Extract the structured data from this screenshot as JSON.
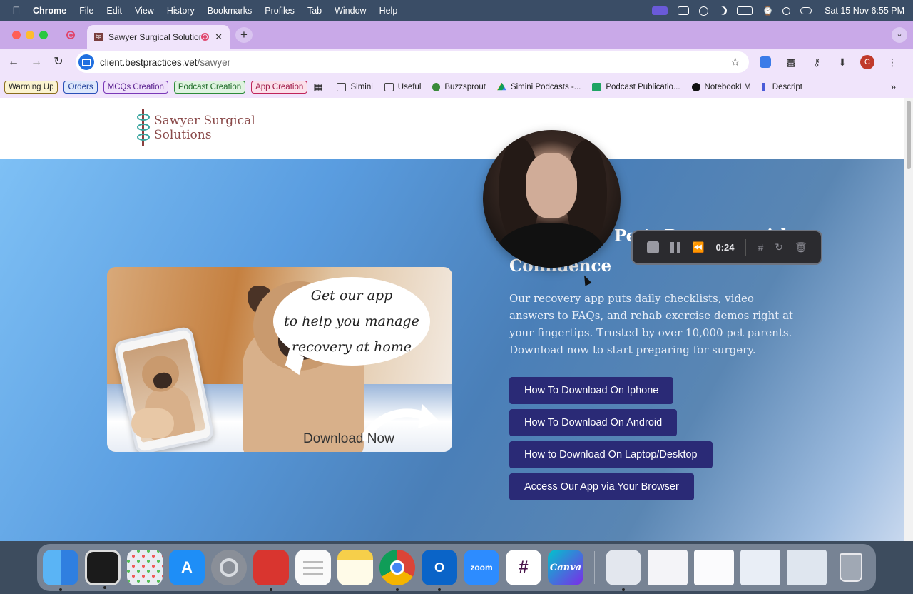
{
  "menubar": {
    "app": "Chrome",
    "items": [
      "File",
      "Edit",
      "View",
      "History",
      "Bookmarks",
      "Profiles",
      "Tab",
      "Window",
      "Help"
    ],
    "clock": "Sat 15 Nov  6:55 PM"
  },
  "browser": {
    "tab_title": "Sawyer Surgical Solutions",
    "new_tab_label": "+",
    "url_host": "client.bestpractices.vet",
    "url_path": "/sawyer",
    "profile_initial": "C",
    "bookmark_pills": [
      {
        "label": "Warming Up",
        "color": "#8a6d1e"
      },
      {
        "label": "Orders",
        "color": "#2a4fb8"
      },
      {
        "label": "MCQs Creation",
        "color": "#7a38b8"
      },
      {
        "label": "Podcast Creation",
        "color": "#2e8b3a"
      },
      {
        "label": "App Creation",
        "color": "#c0245a"
      }
    ],
    "bookmarks": [
      "Simini",
      "Useful",
      "Buzzsprout",
      "Simini Podcasts -...",
      "Podcast Publicatio...",
      "NotebookLM",
      "Descript"
    ]
  },
  "page": {
    "logo_line1": "Sawyer Surgical",
    "logo_line2": "Solutions",
    "hero_title_line1": "Pet's Recovery with",
    "hero_title_line2": "Confidence",
    "hero_description": "Our recovery app puts daily checklists, video answers to FAQs, and rehab exercise demos right at your fingertips. Trusted by over 10,000 pet parents. Download now to start preparing for surgery.",
    "promo_line1": "Get our app",
    "promo_line2": "to help you manage",
    "promo_line3": "recovery at home",
    "promo_cta": "Download Now",
    "buttons": [
      "How To Download On Iphone",
      "How To Download On Android",
      "How to Download On Laptop/Desktop",
      "Access Our App via Your Browser"
    ]
  },
  "recorder": {
    "elapsed": "0:24"
  },
  "dock": {
    "zoom_label": "zoom",
    "canva_label": "Canva"
  }
}
